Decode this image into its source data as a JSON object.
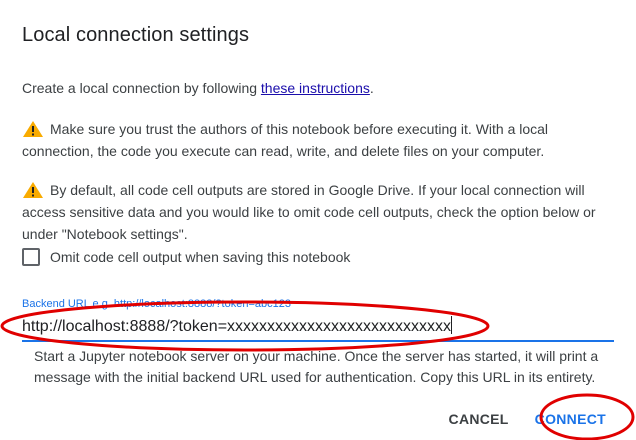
{
  "dialog": {
    "title": "Local connection settings",
    "intro_text": "Create a local connection by following ",
    "intro_link": "these instructions",
    "intro_end": ".",
    "warning1": "Make sure you trust the authors of this notebook before executing it. With a local connection, the code you execute can read, write, and delete files on your computer.",
    "warning2": "By default, all code cell outputs are stored in Google Drive. If your local connection will access sensitive data and you would like to omit code cell outputs, check the option below or under \"Notebook settings\".",
    "checkbox_label": "Omit code cell output when saving this notebook",
    "checkbox_checked": false,
    "field_label": "Backend URL e.g. http://localhost:8888/?token=abc123",
    "field_value": "http://localhost:8888/?token=xxxxxxxxxxxxxxxxxxxxxxxxxxxx",
    "help_text": "Start a Jupyter notebook server on your machine. Once the server has started, it will print a message with the initial backend URL used for authentication. Copy this URL in its entirety.",
    "cancel_label": "CANCEL",
    "connect_label": "CONNECT"
  },
  "colors": {
    "accent": "#1a73e8",
    "warning": "#f9ab00",
    "annotation": "#e00000"
  },
  "icons": {
    "warning": "warning-icon"
  }
}
